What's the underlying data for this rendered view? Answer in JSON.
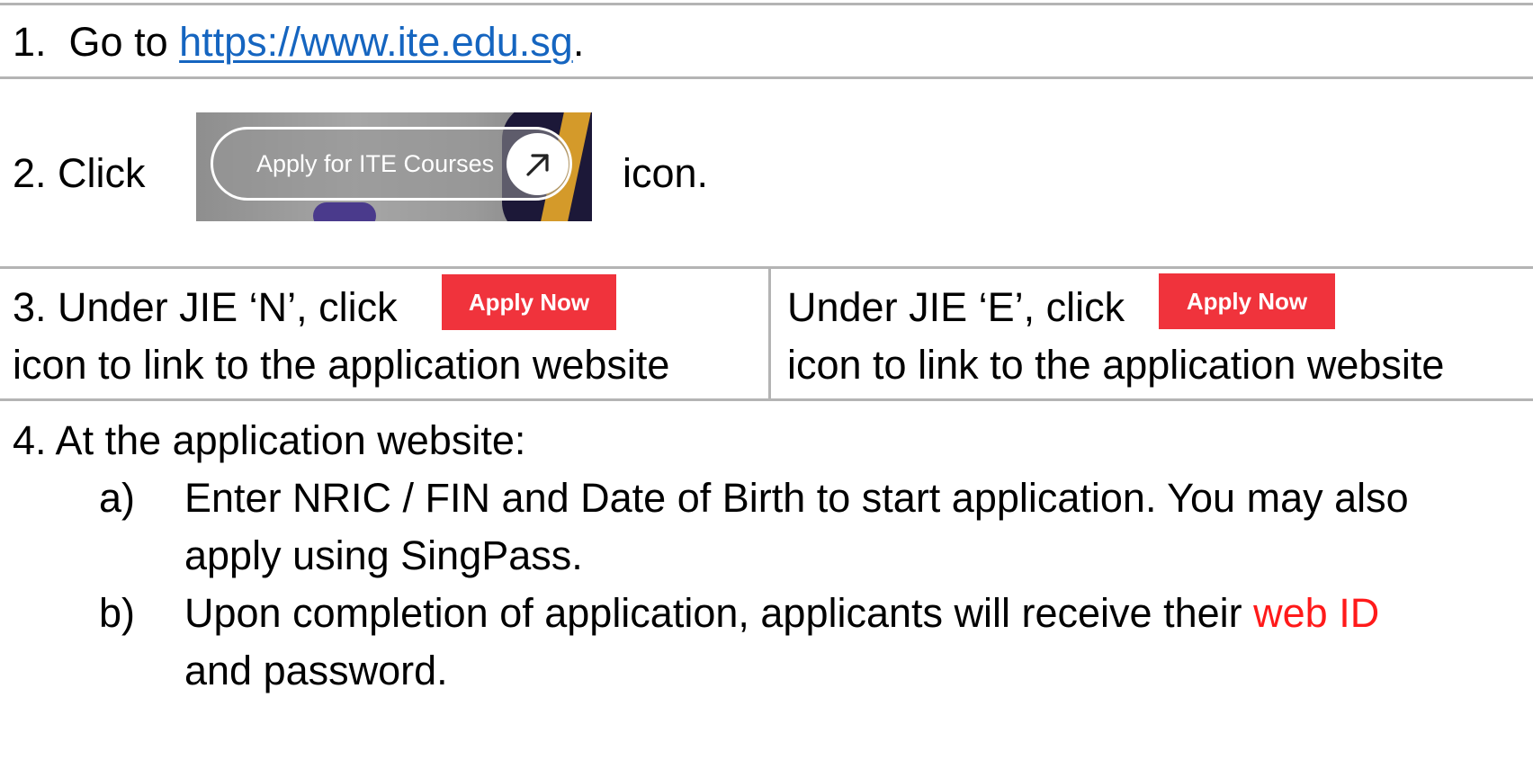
{
  "step1": {
    "prefix": "1.  Go to ",
    "link": "https://www.ite.edu.sg",
    "suffix": "."
  },
  "step2": {
    "prefix": "2. Click",
    "image_label": "Apply for ITE Courses",
    "image_icon": "arrow-up-right-icon",
    "suffix": "icon."
  },
  "step3": {
    "left": {
      "line1": "3. Under JIE ‘N’, click",
      "button": "Apply Now",
      "line2": "icon to link to the application website"
    },
    "right": {
      "line1": "Under JIE ‘E’, click",
      "button": "Apply Now",
      "line2": "icon to link to the application website"
    }
  },
  "step4": {
    "heading": "4. At the application website:",
    "items": [
      {
        "marker": "a)",
        "lines": [
          "Enter NRIC / FIN and Date of Birth to start application. You may also",
          "apply using SingPass."
        ]
      },
      {
        "marker": "b)",
        "line1_prefix": "Upon completion of application, applicants will receive their ",
        "line1_highlight": "web ID",
        "line2": "and password."
      }
    ]
  },
  "colors": {
    "link": "#1565c0",
    "highlight": "#ff1a1a",
    "button": "#f0333c",
    "rule": "#b4b4b4"
  }
}
